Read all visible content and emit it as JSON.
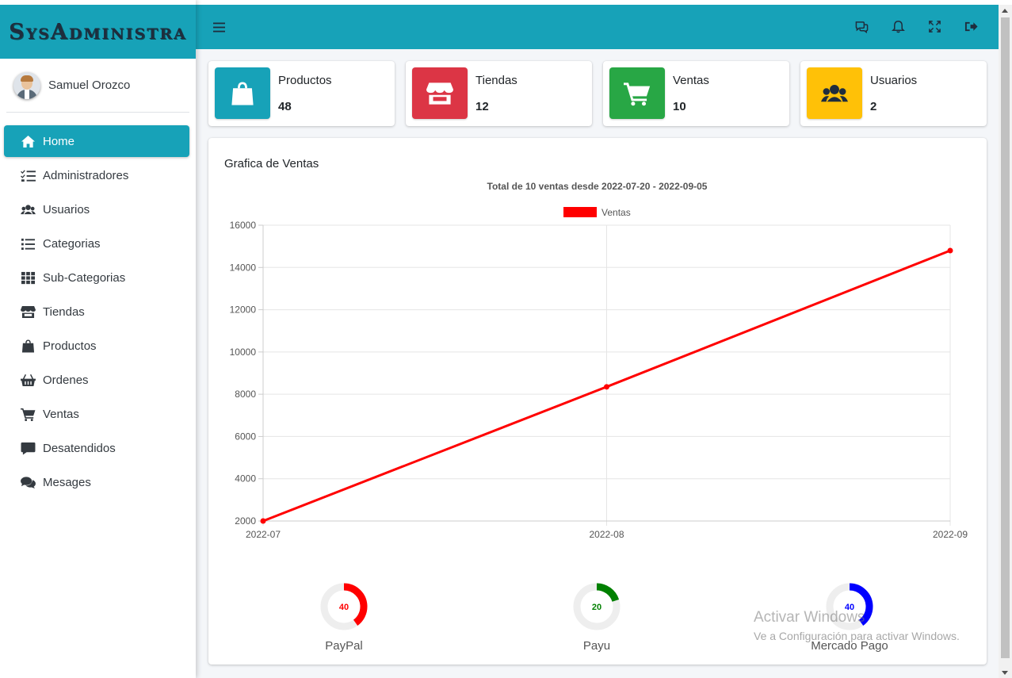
{
  "brand": {
    "title": "SysAdministra"
  },
  "user": {
    "name": "Samuel Orozco"
  },
  "sidebar": {
    "items": [
      {
        "label": "Home",
        "icon": "home-icon",
        "active": true
      },
      {
        "label": "Administradores",
        "icon": "tasks-icon",
        "active": false
      },
      {
        "label": "Usuarios",
        "icon": "users-icon",
        "active": false
      },
      {
        "label": "Categorias",
        "icon": "list-icon",
        "active": false
      },
      {
        "label": "Sub-Categorias",
        "icon": "grid-icon",
        "active": false
      },
      {
        "label": "Tiendas",
        "icon": "store-icon",
        "active": false
      },
      {
        "label": "Productos",
        "icon": "shopping-bag-icon",
        "active": false
      },
      {
        "label": "Ordenes",
        "icon": "basket-icon",
        "active": false
      },
      {
        "label": "Ventas",
        "icon": "cart-icon",
        "active": false
      },
      {
        "label": "Desatendidos",
        "icon": "comment-icon",
        "active": false
      },
      {
        "label": "Mesages",
        "icon": "comments-icon",
        "active": false
      }
    ]
  },
  "topbar": {
    "icons": [
      "menu-icon",
      "chat-icon",
      "bell-icon",
      "expand-icon",
      "logout-icon"
    ]
  },
  "info_boxes": [
    {
      "label": "Productos",
      "value": "48",
      "color": "#17a2b8",
      "icon": "shopping-bag-icon"
    },
    {
      "label": "Tiendas",
      "value": "12",
      "color": "#dc3545",
      "icon": "store-icon"
    },
    {
      "label": "Ventas",
      "value": "10",
      "color": "#28a745",
      "icon": "cart-icon"
    },
    {
      "label": "Usuarios",
      "value": "2",
      "color": "#ffc107",
      "icon": "users-icon"
    }
  ],
  "card": {
    "title": "Grafica de Ventas"
  },
  "chart_data": {
    "type": "line",
    "title": "Total de 10 ventas desde 2022-07-20 - 2022-09-05",
    "x": [
      "2022-07",
      "2022-08",
      "2022-09"
    ],
    "series": [
      {
        "name": "Ventas",
        "values": [
          2000,
          8350,
          14800
        ],
        "color": "#ff0000"
      }
    ],
    "ylim": [
      2000,
      16000
    ],
    "yticks": [
      2000,
      4000,
      6000,
      8000,
      10000,
      12000,
      14000,
      16000
    ],
    "grid": true,
    "legend": "top"
  },
  "donuts": [
    {
      "label": "PayPal",
      "value": 40,
      "max": 100,
      "color": "#ff0000"
    },
    {
      "label": "Payu",
      "value": 20,
      "max": 100,
      "color": "#008000"
    },
    {
      "label": "Mercado Pago",
      "value": 40,
      "max": 100,
      "color": "#0000ff"
    }
  ],
  "watermark": {
    "line1": "Activar Windows",
    "line2": "Ve a Configuración para activar Windows."
  }
}
